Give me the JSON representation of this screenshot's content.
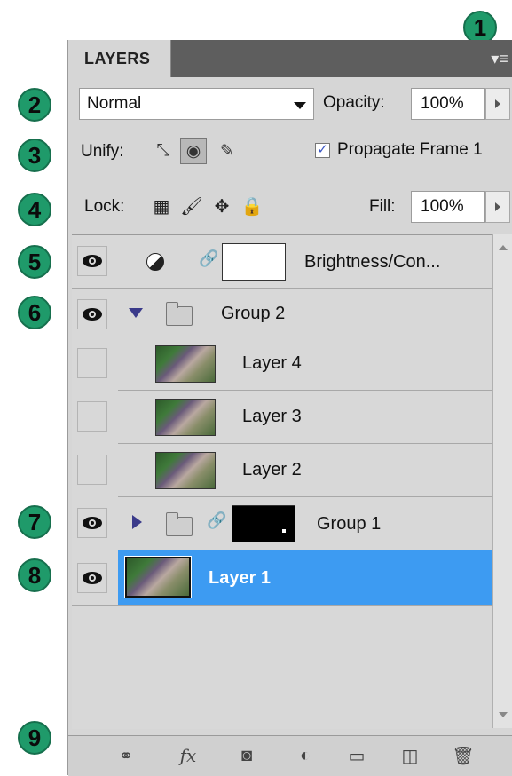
{
  "callouts": [
    "1",
    "2",
    "3",
    "4",
    "5",
    "6",
    "7",
    "8",
    "9"
  ],
  "panel": {
    "tab_label": "LAYERS",
    "menu_icon": "panel-menu-icon"
  },
  "blend": {
    "mode": "Normal",
    "opacity_label": "Opacity:",
    "opacity_value": "100%"
  },
  "unify": {
    "label": "Unify:",
    "propagate_label": "Propagate Frame 1",
    "propagate_checked": true
  },
  "lock": {
    "label": "Lock:",
    "fill_label": "Fill:",
    "fill_value": "100%"
  },
  "layers": [
    {
      "name": "Brightness/Con...",
      "visible": true,
      "kind": "adjustment"
    },
    {
      "name": "Group 2",
      "visible": true,
      "kind": "group-expanded"
    },
    {
      "name": "Layer 4",
      "visible": false,
      "kind": "layer-in-group"
    },
    {
      "name": "Layer 3",
      "visible": false,
      "kind": "layer-in-group"
    },
    {
      "name": "Layer 2",
      "visible": false,
      "kind": "layer-in-group"
    },
    {
      "name": "Group 1",
      "visible": true,
      "kind": "group-collapsed-masked"
    },
    {
      "name": "Layer 1",
      "visible": true,
      "kind": "layer-selected"
    }
  ],
  "colors": {
    "accent_selected": "#3d9bf2",
    "callout": "#1f9a6a",
    "tab_bar": "#5e5e5e"
  },
  "bottom_icons": [
    "link-layers-icon",
    "fx-icon",
    "add-mask-icon",
    "adjustment-layer-icon",
    "new-group-icon",
    "new-layer-icon",
    "delete-layer-icon"
  ]
}
